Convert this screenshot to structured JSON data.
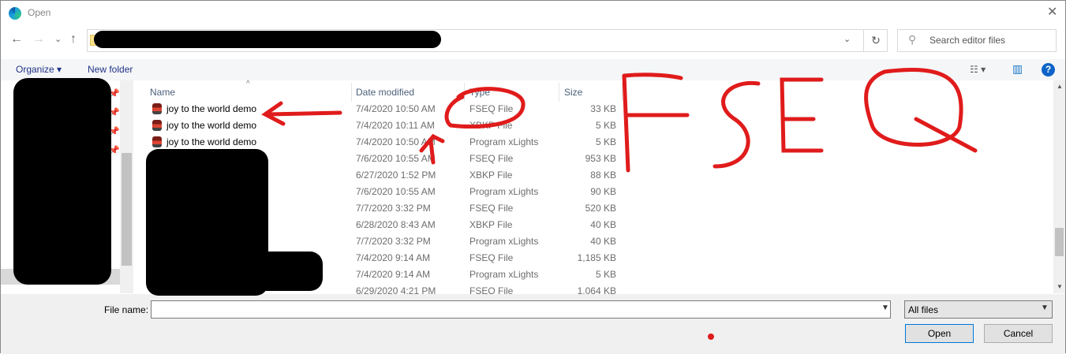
{
  "window": {
    "title": "Open",
    "close": "✕"
  },
  "nav": {
    "back": "←",
    "forward": "→",
    "recent": "⌄",
    "up": "↑",
    "refresh": "↻",
    "address_dropdown": "⌄"
  },
  "search": {
    "placeholder": "Search editor files",
    "icon": "⚲"
  },
  "toolbar": {
    "organize": "Organize ▾",
    "new_folder": "New folder",
    "view": "☷ ▾",
    "preview": "▥",
    "help": "?"
  },
  "columns": {
    "name": "Name",
    "date": "Date modified",
    "type": "Type",
    "size": "Size",
    "sort": "^"
  },
  "files": [
    {
      "name": "joy to the world demo",
      "date": "7/4/2020 10:50 AM",
      "type": "FSEQ File",
      "size": "33 KB"
    },
    {
      "name": "joy to the world demo",
      "date": "7/4/2020 10:11 AM",
      "type": "XBKP File",
      "size": "5 KB"
    },
    {
      "name": "joy to the world demo",
      "date": "7/4/2020 10:50 AM",
      "type": "Program xLights",
      "size": "5 KB"
    },
    {
      "name": "",
      "date": "7/6/2020 10:55 AM",
      "type": "FSEQ File",
      "size": "953 KB"
    },
    {
      "name": "",
      "date": "6/27/2020 1:52 PM",
      "type": "XBKP File",
      "size": "88 KB"
    },
    {
      "name": "",
      "date": "7/6/2020 10:55 AM",
      "type": "Program xLights",
      "size": "90 KB"
    },
    {
      "name": "",
      "date": "7/7/2020 3:32 PM",
      "type": "FSEQ File",
      "size": "520 KB"
    },
    {
      "name": "",
      "date": "6/28/2020 8:43 AM",
      "type": "XBKP File",
      "size": "40 KB"
    },
    {
      "name": "",
      "date": "7/7/2020 3:32 PM",
      "type": "Program xLights",
      "size": "40 KB"
    },
    {
      "name": "",
      "date": "7/4/2020 9:14 AM",
      "type": "FSEQ File",
      "size": "1,185 KB"
    },
    {
      "name": "",
      "date": "7/4/2020 9:14 AM",
      "type": "Program xLights",
      "size": "5 KB"
    },
    {
      "name": "",
      "date": "6/29/2020 4:21 PM",
      "type": "FSEQ File",
      "size": "1,064 KB"
    }
  ],
  "footer": {
    "file_name_label": "File name:",
    "file_name_value": "",
    "filter": "All files",
    "open": "Open",
    "cancel": "Cancel"
  },
  "annotation": {
    "text": "FSEQ",
    "color": "#e01b1b"
  }
}
